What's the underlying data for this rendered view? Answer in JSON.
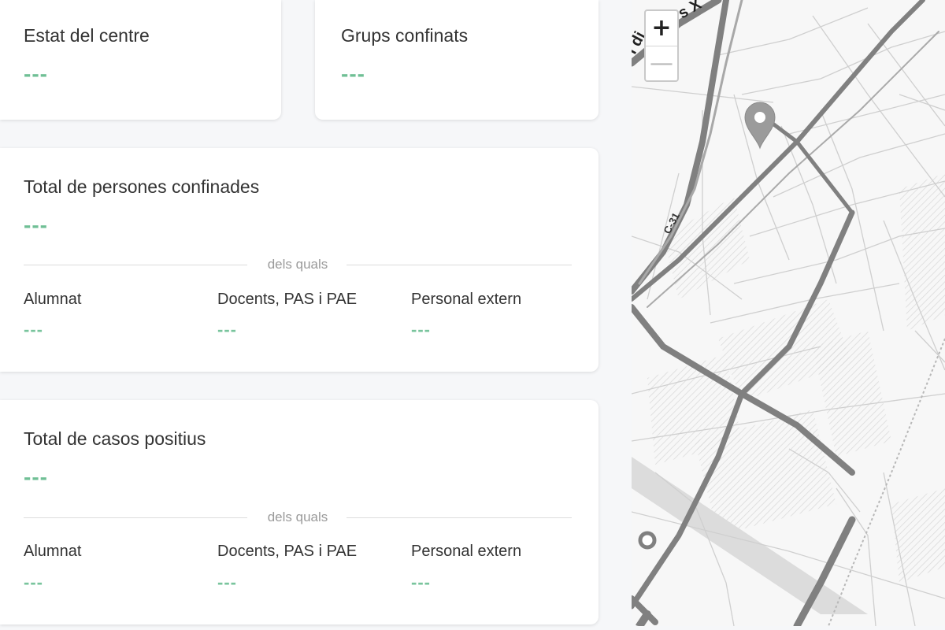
{
  "cards": {
    "estat": {
      "title": "Estat del centre",
      "value": "---"
    },
    "grups": {
      "title": "Grups confinats",
      "value": "---"
    },
    "confinades": {
      "title": "Total de persones confinades",
      "value": "---",
      "divider": "dels quals",
      "breakdown": [
        {
          "label": "Alumnat",
          "value": "---"
        },
        {
          "label": "Docents, PAS i PAE",
          "value": "---"
        },
        {
          "label": "Personal extern",
          "value": "---"
        }
      ]
    },
    "positius": {
      "title": "Total de casos positius",
      "value": "---",
      "divider": "dels quals",
      "breakdown": [
        {
          "label": "Alumnat",
          "value": "---"
        },
        {
          "label": "Docents, PAS i PAE",
          "value": "---"
        },
        {
          "label": "Personal extern",
          "value": "---"
        }
      ]
    }
  },
  "map": {
    "zoom_in": "+",
    "zoom_out": "—",
    "road_label_c31": "C-31",
    "road_label_top": "s X",
    "road_label_left": "l di",
    "marker_icon": "map-pin-icon",
    "colors": {
      "major_road": "#7d7d7d",
      "minor_road": "#cfcfcf",
      "background": "#f7f7f7"
    }
  },
  "colors": {
    "accent": "#6fbf95",
    "card_bg": "#ffffff",
    "page_bg": "#f6f7f9"
  }
}
